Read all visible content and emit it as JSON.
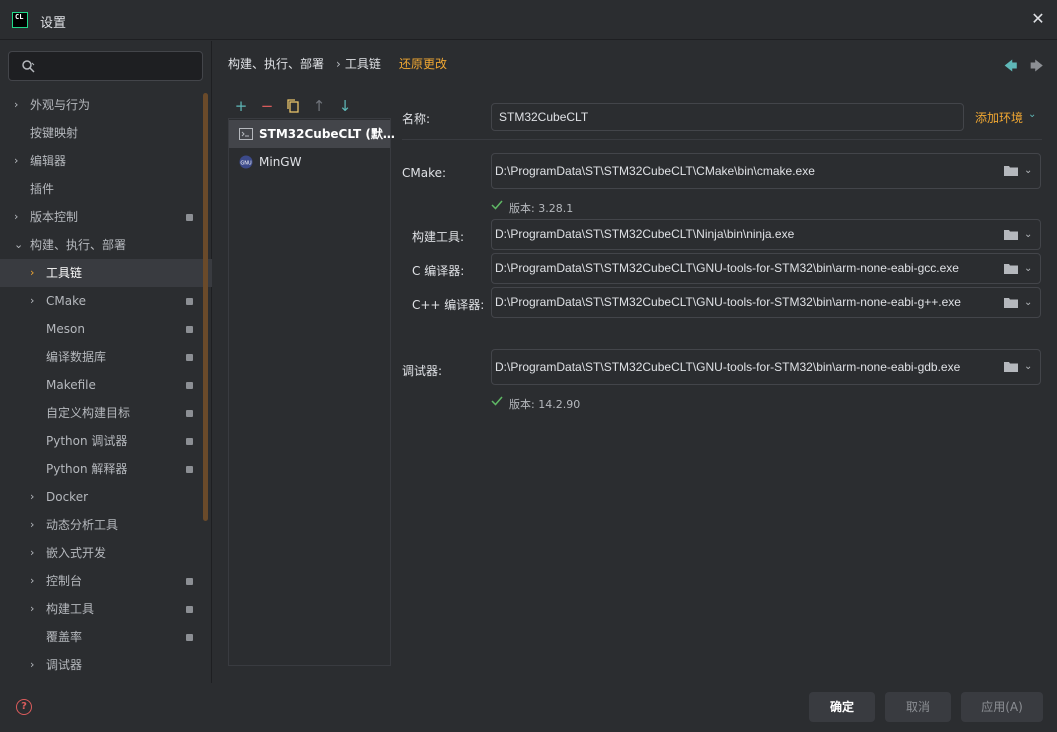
{
  "window": {
    "title": "设置",
    "logo_text": "CL"
  },
  "search": {
    "placeholder": "",
    "value": ""
  },
  "nav": {
    "items": [
      {
        "label": "外观与行为",
        "expandable": true,
        "badge": false,
        "level": 0
      },
      {
        "label": "按键映射",
        "expandable": false,
        "badge": false,
        "level": 0
      },
      {
        "label": "编辑器",
        "expandable": true,
        "badge": false,
        "level": 0
      },
      {
        "label": "插件",
        "expandable": false,
        "badge": false,
        "level": 0
      },
      {
        "label": "版本控制",
        "expandable": true,
        "badge": true,
        "level": 0
      },
      {
        "label": "构建、执行、部署",
        "expandable": true,
        "expanded": true,
        "badge": false,
        "level": 0
      },
      {
        "label": "工具链",
        "expandable": true,
        "badge": false,
        "level": 1,
        "selected": true
      },
      {
        "label": "CMake",
        "expandable": true,
        "badge": true,
        "level": 1
      },
      {
        "label": "Meson",
        "expandable": false,
        "badge": true,
        "level": 1
      },
      {
        "label": "编译数据库",
        "expandable": false,
        "badge": true,
        "level": 1
      },
      {
        "label": "Makefile",
        "expandable": false,
        "badge": true,
        "level": 1
      },
      {
        "label": "自定义构建目标",
        "expandable": false,
        "badge": true,
        "level": 1
      },
      {
        "label": "Python 调试器",
        "expandable": false,
        "badge": true,
        "level": 1
      },
      {
        "label": "Python 解释器",
        "expandable": false,
        "badge": true,
        "level": 1
      },
      {
        "label": "Docker",
        "expandable": true,
        "badge": false,
        "level": 1
      },
      {
        "label": "动态分析工具",
        "expandable": true,
        "badge": false,
        "level": 1
      },
      {
        "label": "嵌入式开发",
        "expandable": true,
        "badge": false,
        "level": 1
      },
      {
        "label": "控制台",
        "expandable": true,
        "badge": true,
        "level": 1
      },
      {
        "label": "构建工具",
        "expandable": true,
        "badge": true,
        "level": 1
      },
      {
        "label": "覆盖率",
        "expandable": false,
        "badge": true,
        "level": 1
      },
      {
        "label": "调试器",
        "expandable": true,
        "badge": false,
        "level": 1
      }
    ]
  },
  "breadcrumb": {
    "parent": "构建、执行、部署",
    "current": "工具链",
    "revert": "还原更改"
  },
  "toolchains": {
    "items": [
      {
        "label": "STM32CubeCLT (默…",
        "selected": true,
        "icon": "terminal-icon"
      },
      {
        "label": "MinGW",
        "selected": false,
        "icon": "gnu-icon"
      }
    ]
  },
  "form": {
    "name_label": "名称:",
    "name_value": "STM32CubeCLT",
    "add_env": "添加环境",
    "cmake_label": "CMake:",
    "cmake_value": "D:\\ProgramData\\ST\\STM32CubeCLT\\CMake\\bin\\cmake.exe",
    "cmake_version": "版本: 3.28.1",
    "build_tool_label": "构建工具:",
    "build_tool_value": "D:\\ProgramData\\ST\\STM32CubeCLT\\Ninja\\bin\\ninja.exe",
    "c_compiler_label": "C 编译器:",
    "c_compiler_value": "D:\\ProgramData\\ST\\STM32CubeCLT\\GNU-tools-for-STM32\\bin\\arm-none-eabi-gcc.exe",
    "cpp_compiler_label": "C++ 编译器:",
    "cpp_compiler_value": "D:\\ProgramData\\ST\\STM32CubeCLT\\GNU-tools-for-STM32\\bin\\arm-none-eabi-g++.exe",
    "debugger_label": "调试器:",
    "debugger_value": "D:\\ProgramData\\ST\\STM32CubeCLT\\GNU-tools-for-STM32\\bin\\arm-none-eabi-gdb.exe",
    "debugger_version": "版本: 14.2.90"
  },
  "footer": {
    "ok": "确定",
    "cancel": "取消",
    "apply": "应用(A)"
  },
  "colors": {
    "accent": "#f0a732",
    "teal": "#5fb8b8",
    "background": "#2b2d30",
    "check": "#5fb865"
  }
}
